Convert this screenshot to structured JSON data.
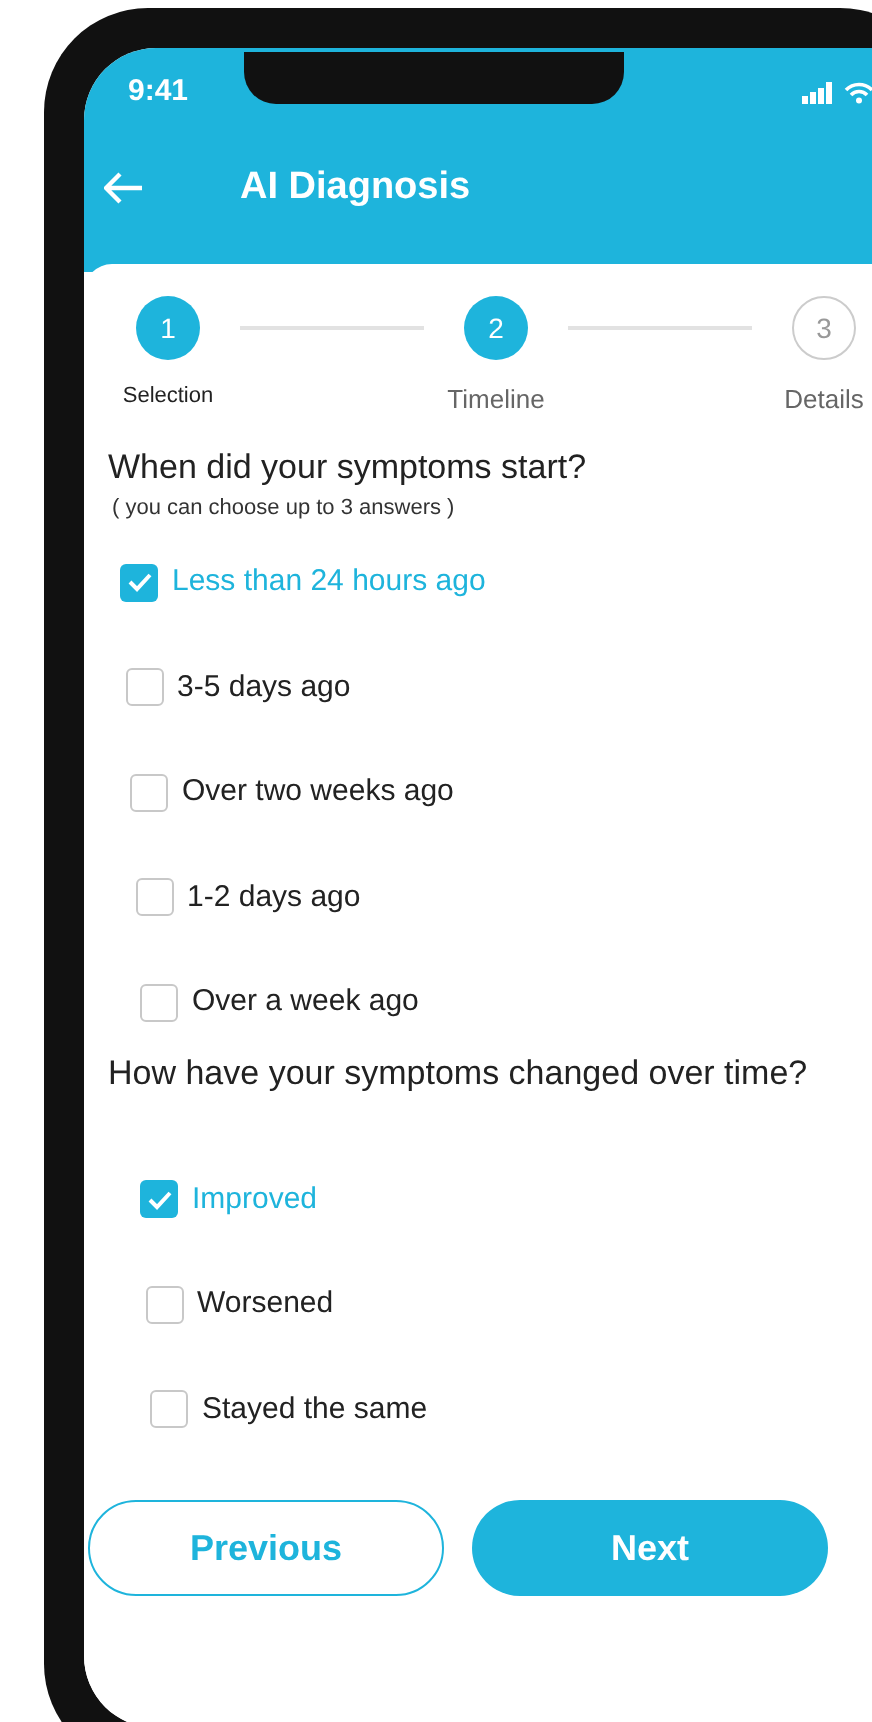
{
  "status_bar": {
    "time": "9:41"
  },
  "header": {
    "title": "AI Diagnosis"
  },
  "steps": [
    {
      "number": "1",
      "label": "Selection",
      "active": true
    },
    {
      "number": "2",
      "label": "Timeline",
      "active": true
    },
    {
      "number": "3",
      "label": "Details",
      "active": false
    }
  ],
  "questions": [
    {
      "title": "When did your symptoms start?",
      "hint": "( you can choose up to 3 answers )",
      "options": [
        {
          "label": "Less than 24 hours ago",
          "checked": true
        },
        {
          "label": "3-5 days ago",
          "checked": false
        },
        {
          "label": "Over two weeks ago",
          "checked": false
        },
        {
          "label": "1-2 days ago",
          "checked": false
        },
        {
          "label": "Over a week ago",
          "checked": false
        }
      ]
    },
    {
      "title": "How have your symptoms changed over time?",
      "options": [
        {
          "label": "Improved",
          "checked": true
        },
        {
          "label": "Worsened",
          "checked": false
        },
        {
          "label": "Stayed the same",
          "checked": false
        }
      ]
    }
  ],
  "buttons": [
    {
      "label": "Previous",
      "kind": "outline"
    },
    {
      "label": "Next",
      "kind": "filled"
    }
  ]
}
